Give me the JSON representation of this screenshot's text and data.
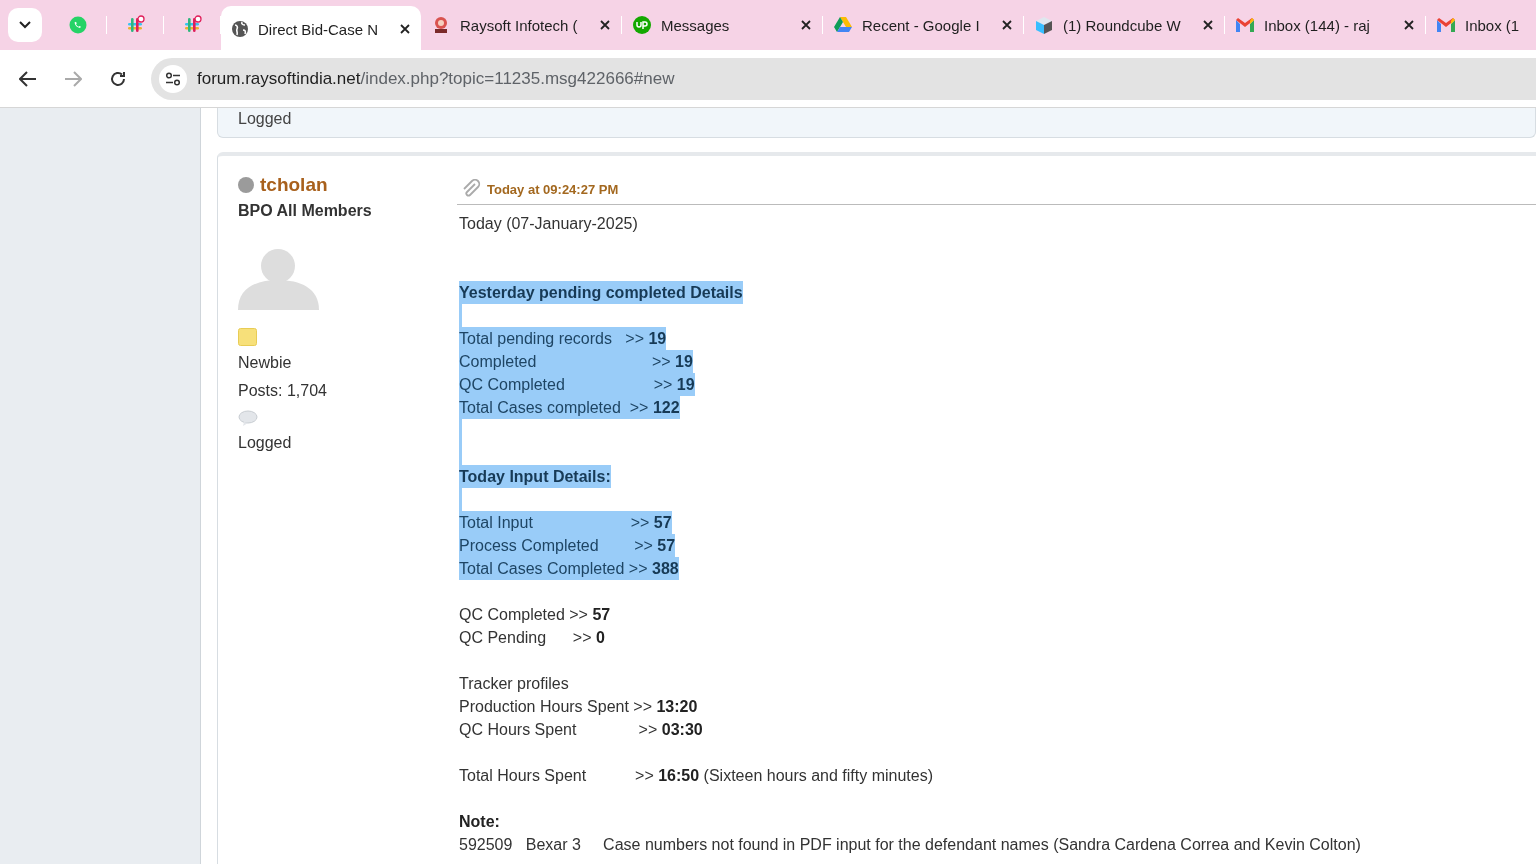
{
  "tabs": [
    {
      "kind": "pinned",
      "selected": false
    },
    {
      "kind": "pinned",
      "selected": false
    },
    {
      "kind": "pinned",
      "selected": false
    },
    {
      "kind": "tab",
      "title": "Direct Bid-Case N",
      "selected": true
    },
    {
      "kind": "tab",
      "title": "Raysoft Infotech (",
      "selected": false
    },
    {
      "kind": "tab",
      "title": "Messages",
      "selected": false
    },
    {
      "kind": "tab",
      "title": "Recent - Google I",
      "selected": false
    },
    {
      "kind": "tab",
      "title": "(1) Roundcube W",
      "selected": false
    },
    {
      "kind": "tab",
      "title": "Inbox (144) - raj",
      "selected": false
    },
    {
      "kind": "tab",
      "title": "Inbox (1",
      "selected": false
    }
  ],
  "address": {
    "host": "forum.raysoftindia.net",
    "path": "/index.php?topic=11235.msg422666#new"
  },
  "previous_post": {
    "footer": "Logged"
  },
  "post": {
    "author": {
      "name": "tcholan",
      "online": false,
      "group": "BPO All Members",
      "rank": "Newbie",
      "posts": "Posts: 1,704",
      "footer": "Logged"
    },
    "time": "Today at 09:24:27 PM",
    "lines": [
      {
        "kind": "text",
        "text": "Today (07-January-2025)",
        "highlighted": false
      },
      {
        "kind": "blank"
      },
      {
        "kind": "blank"
      },
      {
        "kind": "text",
        "text": "**Yesterday pending completed Details**",
        "highlighted": true
      },
      {
        "kind": "blank",
        "highlighted": true
      },
      {
        "kind": "text",
        "text": "Total pending records   >> **19**",
        "highlighted": true
      },
      {
        "kind": "text",
        "text": "Completed                          >> **19**",
        "highlighted": true
      },
      {
        "kind": "text",
        "text": "QC Completed                    >> **19**",
        "highlighted": true
      },
      {
        "kind": "text",
        "text": "Total Cases completed  >> **122**",
        "highlighted": true
      },
      {
        "kind": "blank",
        "highlighted": true
      },
      {
        "kind": "blank",
        "highlighted": true
      },
      {
        "kind": "text",
        "text": "**Today Input Details:**",
        "highlighted": true
      },
      {
        "kind": "blank",
        "highlighted": true
      },
      {
        "kind": "text",
        "text": "Total Input                      >> **57**",
        "highlighted": true
      },
      {
        "kind": "text",
        "text": "Process Completed        >> **57**",
        "highlighted": true
      },
      {
        "kind": "text",
        "text": "Total Cases Completed >> **388**",
        "highlighted": true
      },
      {
        "kind": "blank"
      },
      {
        "kind": "text",
        "text": "QC Completed >> **57**",
        "highlighted": false
      },
      {
        "kind": "text",
        "text": "QC Pending      >> **0**",
        "highlighted": false
      },
      {
        "kind": "blank"
      },
      {
        "kind": "text",
        "text": "Tracker profiles",
        "highlighted": false
      },
      {
        "kind": "text",
        "text": "Production Hours Spent >> **13:20**",
        "highlighted": false
      },
      {
        "kind": "text",
        "text": "QC Hours Spent              >> **03:30**",
        "highlighted": false
      },
      {
        "kind": "blank"
      },
      {
        "kind": "text",
        "text": "Total Hours Spent           >> **16:50** (Sixteen hours and fifty minutes)",
        "highlighted": false
      },
      {
        "kind": "blank"
      },
      {
        "kind": "text",
        "text": "**Note:**",
        "highlighted": false
      },
      {
        "kind": "text",
        "text": "592509   Bexar 3     Case numbers not found in PDF input for the defendant names (Sandra Cardena Correa and Kevin Colton)",
        "highlighted": false
      }
    ]
  }
}
